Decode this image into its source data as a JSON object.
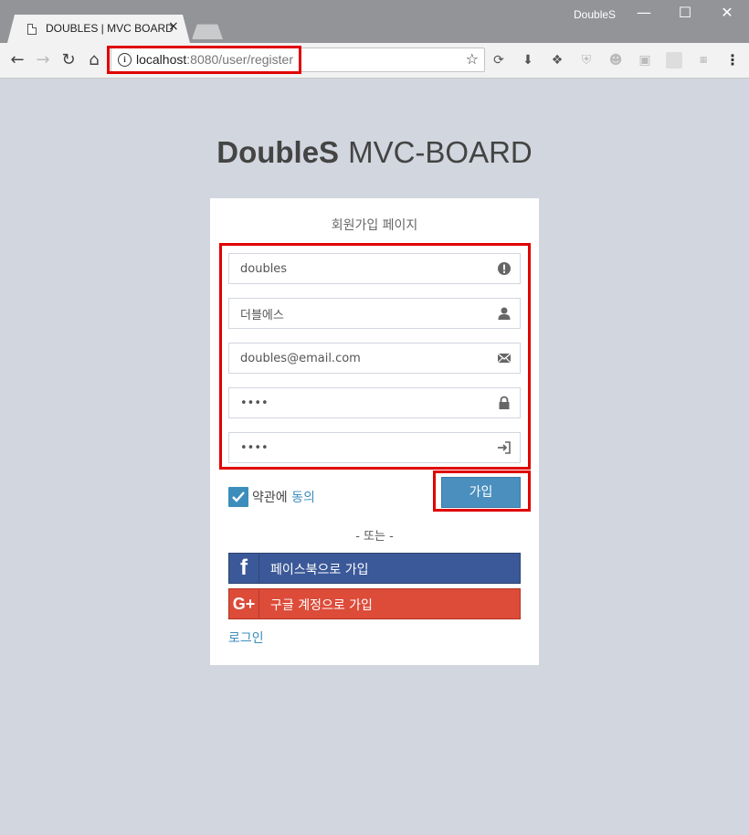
{
  "browser": {
    "tab_title": "DOUBLES | MVC BOARD",
    "tab_close": "×",
    "window_title": "DoubleS",
    "url_host": "localhost",
    "url_rest": ":8080/user/register"
  },
  "page": {
    "logo_bold": "DoubleS",
    "logo_light": "MVC-BOARD",
    "box_message": "회원가입 페이지",
    "fields": {
      "userid": "doubles",
      "name": "더블에스",
      "email": "doubles@email.com",
      "password": "••••",
      "password_confirm": "••••"
    },
    "agree_prefix": "약관에 ",
    "agree_link": "동의",
    "join_button": "가입",
    "divider": "- 또는 -",
    "facebook_button": "페이스북으로 가입",
    "google_button": "구글 계정으로 가입",
    "login_link": "로그인"
  }
}
